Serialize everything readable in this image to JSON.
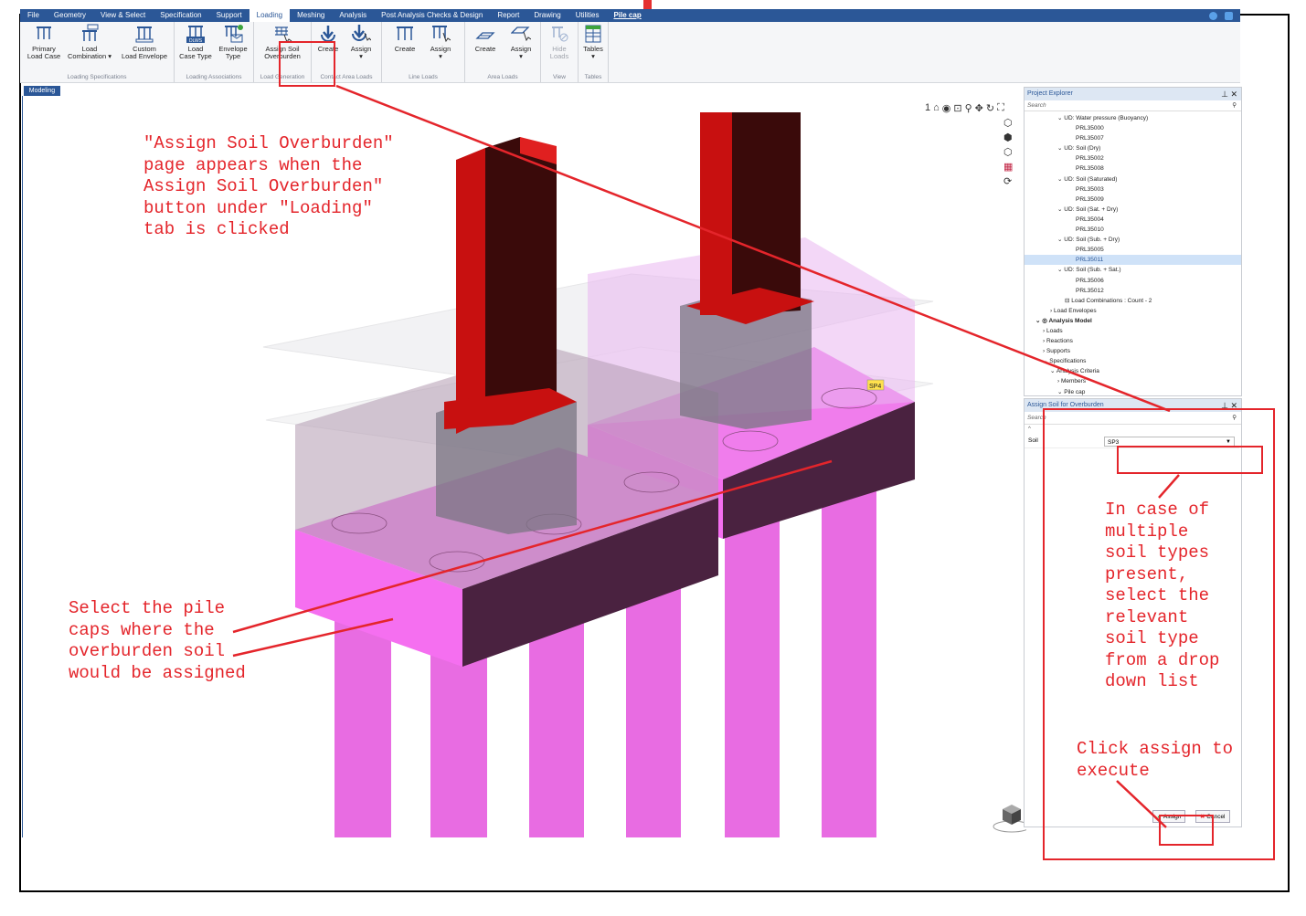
{
  "menubar": {
    "tabs": [
      "File",
      "Geometry",
      "View & Select",
      "Specification",
      "Support",
      "Loading",
      "Meshing",
      "Analysis",
      "Post Analysis Checks & Design",
      "Report",
      "Drawing",
      "Utilities"
    ],
    "active_tab": "Loading",
    "project_title": "Pile cap"
  },
  "ribbon": {
    "primary_load_case": "Primary\nLoad Case",
    "load_combination": "Load\nCombination ▾",
    "custom_load_envelope": "Custom\nLoad Envelope",
    "group_loading_specifications": "Loading Specifications",
    "load_case_type": "Load\nCase Type",
    "envelope_type": "Envelope\nType",
    "group_loading_associations": "Loading Associations",
    "assign_soil_overburden": "Assign Soil\nOverburden",
    "group_load_generation": "Load Generation",
    "create_1": "Create",
    "assign_1": "Assign\n▾",
    "group_contact_area_loads": "Contact Area Loads",
    "create_2": "Create",
    "assign_2": "Assign\n▾",
    "group_line_loads": "Line Loads",
    "create_3": "Create",
    "assign_3": "Assign\n▾",
    "group_area_loads": "Area Loads",
    "hide_loads": "Hide\nLoads",
    "group_view": "View",
    "tables": "Tables\n▾",
    "group_tables": "Tables",
    "dlws_badge": "DLWS"
  },
  "workspace": {
    "tab_label": "Modeling",
    "viewport_marker": "1",
    "support_label": "SP4"
  },
  "project_explorer": {
    "title": "Project Explorer",
    "search_placeholder": "Search",
    "tree": [
      {
        "text": "⌄  UD: Water pressure (Buoyancy)",
        "indent": 36
      },
      {
        "text": "PRL35000",
        "indent": 56
      },
      {
        "text": "PRL35007",
        "indent": 56
      },
      {
        "text": "⌄  UD: Soil (Dry)",
        "indent": 36
      },
      {
        "text": "PRL35002",
        "indent": 56
      },
      {
        "text": "PRL35008",
        "indent": 56
      },
      {
        "text": "⌄  UD: Soil (Saturated)",
        "indent": 36
      },
      {
        "text": "PRL35003",
        "indent": 56
      },
      {
        "text": "PRL35009",
        "indent": 56
      },
      {
        "text": "⌄  UD: Soil (Sat. + Dry)",
        "indent": 36
      },
      {
        "text": "PRL35004",
        "indent": 56
      },
      {
        "text": "PRL35010",
        "indent": 56
      },
      {
        "text": "⌄  UD: Soil (Sub. + Dry)",
        "indent": 36
      },
      {
        "text": "PRL35005",
        "indent": 56
      },
      {
        "text": "PRL35011",
        "indent": 56,
        "selected": true
      },
      {
        "text": "⌄  UD: Soil (Sub. + Sat.)",
        "indent": 36
      },
      {
        "text": "PRL35006",
        "indent": 56
      },
      {
        "text": "PRL35012",
        "indent": 56
      },
      {
        "text": "⊟ Load Combinations : Count - 2",
        "indent": 44
      },
      {
        "text": "›  Load Envelopes",
        "indent": 28
      },
      {
        "text": "⌄ ◎ Analysis Model",
        "indent": 12,
        "bold": true
      },
      {
        "text": "›  Loads",
        "indent": 20
      },
      {
        "text": "›  Reactions",
        "indent": 20
      },
      {
        "text": "›  Supports",
        "indent": 20
      },
      {
        "text": "⌄  Specifications",
        "indent": 20
      },
      {
        "text": "⌄  Analysis Criteria",
        "indent": 28
      },
      {
        "text": "›  Members",
        "indent": 36
      },
      {
        "text": "⌄  Pile cap",
        "indent": 36
      }
    ]
  },
  "assign_panel": {
    "title": "Assign Soil for Overburden",
    "search_placeholder": "Search",
    "property_label": "Soil",
    "soil_value": "SP3",
    "assign_button": "Assign",
    "cancel_button": "Cancel"
  },
  "annotations": {
    "top_left": "\"Assign Soil Overburden\"\npage appears when the\nAssign Soil Overburden\"\nbutton under \"Loading\"\ntab is clicked",
    "bottom_left": "Select the pile\ncaps where the\noverburden soil\nwould be assigned",
    "right_middle": "In case of\nmultiple\nsoil types\npresent,\nselect the\nrelevant\nsoil type\nfrom a drop\ndown list",
    "right_bottom": "Click assign to\nexecute"
  },
  "colors": {
    "menubar": "#2b5797",
    "annotation_red": "#e4252b",
    "column_red": "#c81010",
    "pilecap_magenta": "#f56ff0",
    "pilecap_shadow": "#4a2240"
  }
}
